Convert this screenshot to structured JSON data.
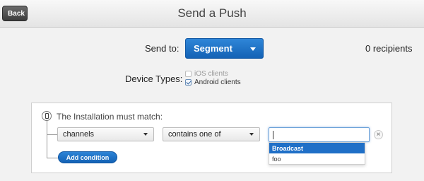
{
  "header": {
    "back_label": "Back",
    "title": "Send a Push"
  },
  "send_to": {
    "label": "Send to:",
    "selected": "Segment",
    "recipients": "0 recipients"
  },
  "device_types": {
    "label": "Device Types:",
    "options": [
      {
        "label": "iOS clients",
        "checked": false,
        "disabled": true
      },
      {
        "label": "Android clients",
        "checked": true,
        "disabled": false
      }
    ]
  },
  "condition_panel": {
    "heading": "The Installation must match:",
    "field_select": "channels",
    "operator_select": "contains one of",
    "value_input": "",
    "suggestions": [
      "Broadcast",
      "foo"
    ],
    "remove_symbol": "×",
    "add_condition_label": "Add condition"
  },
  "icons": {
    "phone": "phone-icon",
    "remove": "close-icon",
    "caret": "chevron-down-icon"
  },
  "colors": {
    "primary_blue": "#1f6fc7",
    "header_bg": "#e9e9e9",
    "back_button": "#4a4a4a"
  }
}
